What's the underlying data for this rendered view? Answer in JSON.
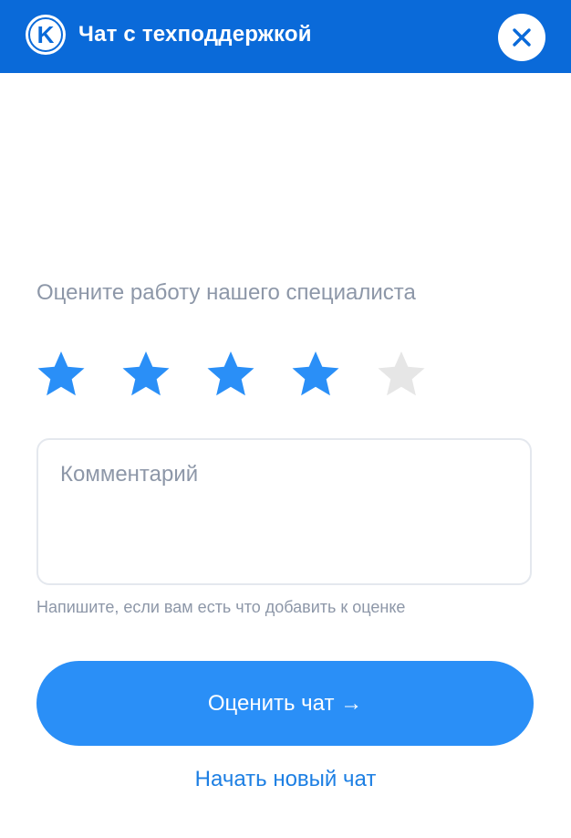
{
  "header": {
    "title": "Чат с техподдержкой",
    "logo_letter": "K",
    "close_icon": "close-icon"
  },
  "rating": {
    "prompt": "Оцените работу нашего специалиста",
    "value": 4,
    "max": 5,
    "star_icon": "star-icon"
  },
  "comment": {
    "placeholder": "Комментарий",
    "value": "",
    "hint": "Напишите, если вам есть что добавить к оценке"
  },
  "actions": {
    "submit_label": "Оценить чат →",
    "new_chat_label": "Начать новый чат"
  },
  "colors": {
    "header_bg": "#0a6ad9",
    "accent": "#2a8ff7",
    "star_active": "#2a8ff7",
    "star_inactive": "#e6e6e6",
    "muted_text": "#8d97a8",
    "link": "#1d7fe3"
  }
}
